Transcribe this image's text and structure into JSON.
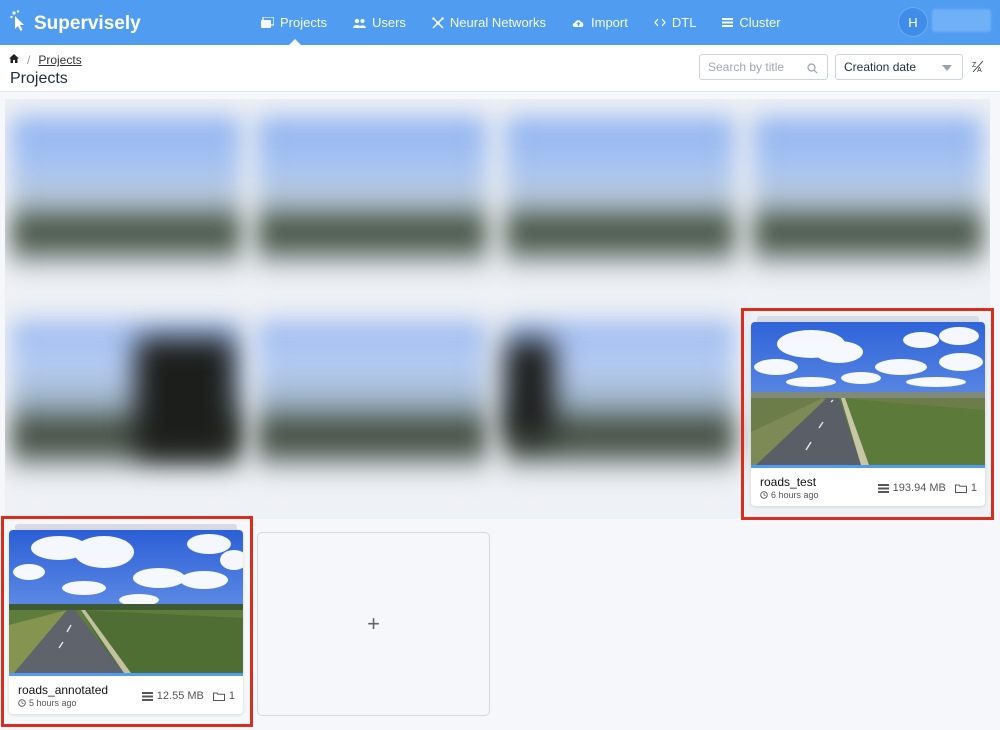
{
  "app": {
    "logo_text": "Supervisely",
    "brand_color": "#4f9cf0"
  },
  "nav": {
    "items": [
      {
        "label": "Projects",
        "icon": "projects-icon",
        "active": true
      },
      {
        "label": "Users",
        "icon": "users-icon",
        "active": false
      },
      {
        "label": "Neural Networks",
        "icon": "neural-networks-icon",
        "active": false
      },
      {
        "label": "Import",
        "icon": "cloud-upload-icon",
        "active": false
      },
      {
        "label": "DTL",
        "icon": "code-icon",
        "active": false
      },
      {
        "label": "Cluster",
        "icon": "list-icon",
        "active": false
      }
    ],
    "avatar_initial": "H"
  },
  "breadcrumb": {
    "home_icon": "home-icon",
    "items": [
      "Projects"
    ]
  },
  "page_title": "Projects",
  "search": {
    "placeholder": "Search by title",
    "value": ""
  },
  "sort": {
    "selected": "Creation date",
    "direction_icon": "sort-direction-icon"
  },
  "projects": [
    {
      "name": "roads_test",
      "time": "6 hours ago",
      "size": "193.94 MB",
      "datasets": "1",
      "highlighted": true
    },
    {
      "name": "roads_annotated",
      "time": "5 hours ago",
      "size": "12.55 MB",
      "datasets": "1",
      "highlighted": true
    }
  ],
  "add_project_label": "+",
  "highlight_color": "#d92d1e"
}
